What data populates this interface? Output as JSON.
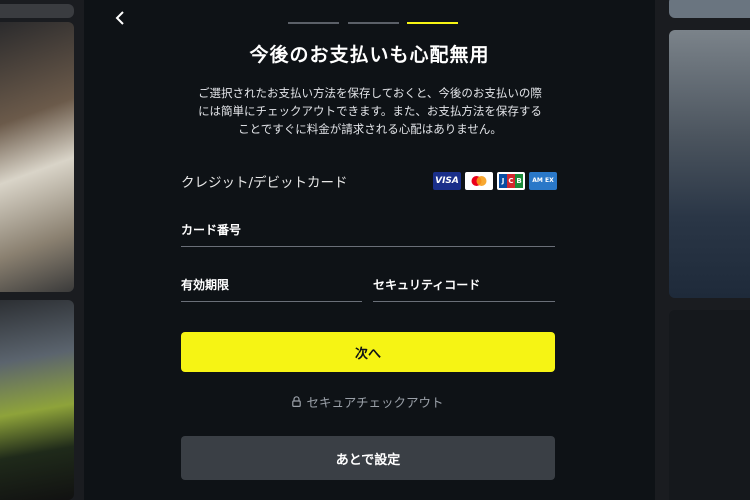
{
  "header": {
    "back_icon": "chevron-left-icon",
    "steps": [
      {
        "state": "complete",
        "color": "#5b6068"
      },
      {
        "state": "complete",
        "color": "#5b6068"
      },
      {
        "state": "current",
        "color": "#f6f414"
      }
    ]
  },
  "main": {
    "title": "今後のお支払いも心配無用",
    "description_lines": [
      "ご選択されたお支払い方法を保存しておくと、今後のお支払いの際",
      "には簡単にチェックアウトできます。また、お支払方法を保存する",
      "ことですぐに料金が請求される心配はありません。"
    ],
    "payment_method_label": "クレジット/デビットカード",
    "card_brands": [
      {
        "name": "visa-icon",
        "text": "VISA"
      },
      {
        "name": "mastercard-icon",
        "text": ""
      },
      {
        "name": "jcb-icon",
        "text": "JCB"
      },
      {
        "name": "amex-icon",
        "text": "AM EX"
      }
    ],
    "fields": {
      "card_number": "カード番号",
      "expiry": "有効期限",
      "security_code": "セキュリティコード"
    },
    "next_button": "次へ",
    "secure_text": "セキュアチェックアウト",
    "later_button": "あとで設定"
  },
  "colors": {
    "accent": "#f6f414",
    "modal_bg": "#0e1216",
    "secondary_button": "#3a3f45"
  }
}
